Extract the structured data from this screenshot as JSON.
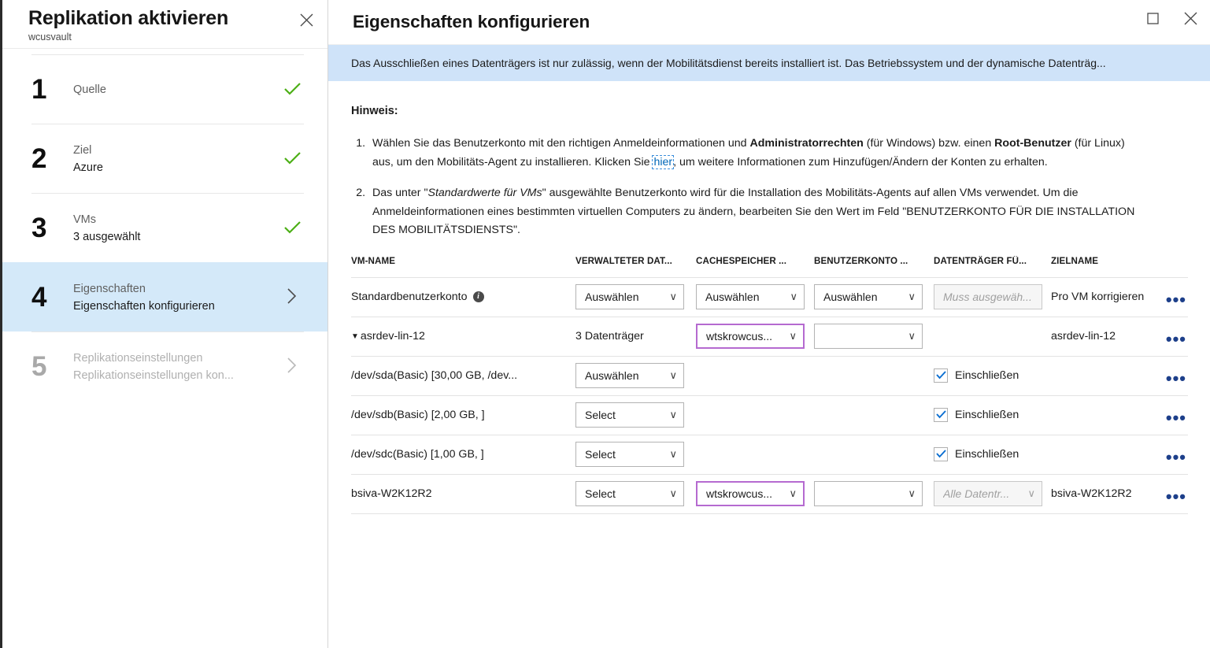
{
  "left_panel": {
    "title": "Replikation aktivieren",
    "subtitle": "wcusvault",
    "close_label": "×",
    "steps": [
      {
        "num": "1",
        "label": "Quelle",
        "value": "",
        "status": "check"
      },
      {
        "num": "2",
        "label": "Ziel",
        "value": "Azure",
        "status": "check"
      },
      {
        "num": "3",
        "label": "VMs",
        "value": "3 ausgewählt",
        "status": "check"
      },
      {
        "num": "4",
        "label": "Eigenschaften",
        "value": "Eigenschaften konfigurieren",
        "status": "chevron"
      },
      {
        "num": "5",
        "label": "Replikationseinstellungen",
        "value": "Replikationseinstellungen kon...",
        "status": "chevron"
      }
    ]
  },
  "right_panel": {
    "title": "Eigenschaften konfigurieren",
    "banner": "Das Ausschließen eines Datenträgers ist nur zulässig, wenn der Mobilitätsdienst bereits installiert ist. Das Betriebssystem und der dynamische Datenträg...",
    "hinweis_label": "Hinweis:",
    "note1": {
      "part1": "Wählen Sie das Benutzerkonto mit den richtigen Anmeldeinformationen und ",
      "bold1": "Administratorrechten",
      "part2": " (für Windows) bzw. einen ",
      "bold2": "Root-Benutzer",
      "part3": " (für Linux) aus, um den Mobilitäts-Agent zu installieren. Klicken Sie ",
      "link": "hier",
      "part4": ", um weitere Informationen zum Hinzufügen/Ändern der Konten zu erhalten."
    },
    "note2": {
      "part1": "Das unter \"",
      "italic1": "Standardwerte für VMs",
      "part2": "\" ausgewählte Benutzerkonto wird für die Installation des Mobilitäts-Agents auf allen VMs verwendet. Um die Anmeldeinformationen eines bestimmten virtuellen Computers zu ändern, bearbeiten Sie den Wert im Feld \"BENUTZERKONTO FÜR DIE INSTALLATION DES MOBILITÄTSDIENSTS\"."
    },
    "table": {
      "headers": [
        "VM-NAME",
        "VERWALTETER DAT...",
        "CACHESPEICHER ...",
        "BENUTZERKONTO ...",
        "DATENTRÄGER FÜ...",
        "ZIELNAME",
        ""
      ],
      "rows": [
        {
          "type": "default",
          "name": "Standardbenutzerkonto",
          "info_icon": "i",
          "managed_disk": {
            "kind": "select",
            "value": "Auswählen",
            "state": "normal"
          },
          "cache": {
            "kind": "select",
            "value": "Auswählen",
            "state": "normal"
          },
          "account": {
            "kind": "select",
            "value": "Auswählen",
            "state": "normal"
          },
          "disks": {
            "kind": "select",
            "value": "Muss ausgewäh...",
            "state": "disabled"
          },
          "target": "Pro VM korrigieren",
          "more": "•••"
        },
        {
          "type": "vm",
          "expander": "▼",
          "name": "asrdev-lin-12",
          "managed_disk": {
            "kind": "text",
            "value": "3 Datenträger"
          },
          "cache": {
            "kind": "select",
            "value": "wtskrowcus...",
            "state": "highlight"
          },
          "account": {
            "kind": "select",
            "value": "",
            "state": "normal"
          },
          "disks": {
            "kind": "none",
            "value": ""
          },
          "target": "asrdev-lin-12",
          "more": "•••"
        },
        {
          "type": "disk",
          "name": "/dev/sda(Basic) [30,00 GB, /dev...",
          "managed_disk": {
            "kind": "select",
            "value": "Auswählen",
            "state": "normal"
          },
          "cache": {
            "kind": "none",
            "value": ""
          },
          "account": {
            "kind": "none",
            "value": ""
          },
          "disks": {
            "kind": "checkbox",
            "value": "Einschließen",
            "checked": true
          },
          "target": "",
          "more": "•••"
        },
        {
          "type": "disk",
          "name": "/dev/sdb(Basic) [2,00 GB, ]",
          "managed_disk": {
            "kind": "select",
            "value": "Select",
            "state": "normal"
          },
          "cache": {
            "kind": "none",
            "value": ""
          },
          "account": {
            "kind": "none",
            "value": ""
          },
          "disks": {
            "kind": "checkbox",
            "value": "Einschließen",
            "checked": true
          },
          "target": "",
          "more": "•••"
        },
        {
          "type": "disk",
          "name": "/dev/sdc(Basic) [1,00 GB, ]",
          "managed_disk": {
            "kind": "select",
            "value": "Select",
            "state": "normal"
          },
          "cache": {
            "kind": "none",
            "value": ""
          },
          "account": {
            "kind": "none",
            "value": ""
          },
          "disks": {
            "kind": "checkbox",
            "value": "Einschließen",
            "checked": true
          },
          "target": "",
          "more": "•••"
        },
        {
          "type": "vm",
          "expander": "",
          "name": "bsiva-W2K12R2",
          "managed_disk": {
            "kind": "select",
            "value": "Select",
            "state": "normal"
          },
          "cache": {
            "kind": "select",
            "value": "wtskrowcus...",
            "state": "highlight"
          },
          "account": {
            "kind": "select",
            "value": "",
            "state": "normal"
          },
          "disks": {
            "kind": "select",
            "value": "Alle Datentr...",
            "state": "disabled"
          },
          "target": "bsiva-W2K12R2",
          "more": "•••"
        }
      ]
    }
  },
  "colors": {
    "accent_blue": "#0067b8",
    "banner_bg": "#cfe3f9",
    "active_step_bg": "#d4e9f9",
    "check_green": "#4caf16",
    "highlight_purple": "#b56ad0",
    "checkbox_blue": "#0a6ed1",
    "more_dots": "#1d3f8a"
  }
}
